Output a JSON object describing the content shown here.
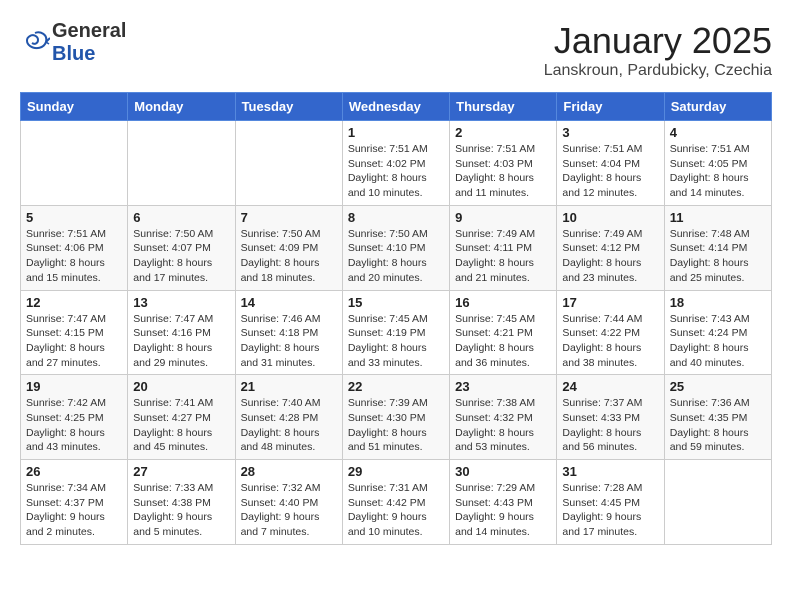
{
  "header": {
    "logo": {
      "general": "General",
      "blue": "Blue"
    },
    "title": "January 2025",
    "subtitle": "Lanskroun, Pardubicky, Czechia"
  },
  "weekdays": [
    "Sunday",
    "Monday",
    "Tuesday",
    "Wednesday",
    "Thursday",
    "Friday",
    "Saturday"
  ],
  "weeks": [
    [
      {
        "day": "",
        "detail": ""
      },
      {
        "day": "",
        "detail": ""
      },
      {
        "day": "",
        "detail": ""
      },
      {
        "day": "1",
        "detail": "Sunrise: 7:51 AM\nSunset: 4:02 PM\nDaylight: 8 hours\nand 10 minutes."
      },
      {
        "day": "2",
        "detail": "Sunrise: 7:51 AM\nSunset: 4:03 PM\nDaylight: 8 hours\nand 11 minutes."
      },
      {
        "day": "3",
        "detail": "Sunrise: 7:51 AM\nSunset: 4:04 PM\nDaylight: 8 hours\nand 12 minutes."
      },
      {
        "day": "4",
        "detail": "Sunrise: 7:51 AM\nSunset: 4:05 PM\nDaylight: 8 hours\nand 14 minutes."
      }
    ],
    [
      {
        "day": "5",
        "detail": "Sunrise: 7:51 AM\nSunset: 4:06 PM\nDaylight: 8 hours\nand 15 minutes."
      },
      {
        "day": "6",
        "detail": "Sunrise: 7:50 AM\nSunset: 4:07 PM\nDaylight: 8 hours\nand 17 minutes."
      },
      {
        "day": "7",
        "detail": "Sunrise: 7:50 AM\nSunset: 4:09 PM\nDaylight: 8 hours\nand 18 minutes."
      },
      {
        "day": "8",
        "detail": "Sunrise: 7:50 AM\nSunset: 4:10 PM\nDaylight: 8 hours\nand 20 minutes."
      },
      {
        "day": "9",
        "detail": "Sunrise: 7:49 AM\nSunset: 4:11 PM\nDaylight: 8 hours\nand 21 minutes."
      },
      {
        "day": "10",
        "detail": "Sunrise: 7:49 AM\nSunset: 4:12 PM\nDaylight: 8 hours\nand 23 minutes."
      },
      {
        "day": "11",
        "detail": "Sunrise: 7:48 AM\nSunset: 4:14 PM\nDaylight: 8 hours\nand 25 minutes."
      }
    ],
    [
      {
        "day": "12",
        "detail": "Sunrise: 7:47 AM\nSunset: 4:15 PM\nDaylight: 8 hours\nand 27 minutes."
      },
      {
        "day": "13",
        "detail": "Sunrise: 7:47 AM\nSunset: 4:16 PM\nDaylight: 8 hours\nand 29 minutes."
      },
      {
        "day": "14",
        "detail": "Sunrise: 7:46 AM\nSunset: 4:18 PM\nDaylight: 8 hours\nand 31 minutes."
      },
      {
        "day": "15",
        "detail": "Sunrise: 7:45 AM\nSunset: 4:19 PM\nDaylight: 8 hours\nand 33 minutes."
      },
      {
        "day": "16",
        "detail": "Sunrise: 7:45 AM\nSunset: 4:21 PM\nDaylight: 8 hours\nand 36 minutes."
      },
      {
        "day": "17",
        "detail": "Sunrise: 7:44 AM\nSunset: 4:22 PM\nDaylight: 8 hours\nand 38 minutes."
      },
      {
        "day": "18",
        "detail": "Sunrise: 7:43 AM\nSunset: 4:24 PM\nDaylight: 8 hours\nand 40 minutes."
      }
    ],
    [
      {
        "day": "19",
        "detail": "Sunrise: 7:42 AM\nSunset: 4:25 PM\nDaylight: 8 hours\nand 43 minutes."
      },
      {
        "day": "20",
        "detail": "Sunrise: 7:41 AM\nSunset: 4:27 PM\nDaylight: 8 hours\nand 45 minutes."
      },
      {
        "day": "21",
        "detail": "Sunrise: 7:40 AM\nSunset: 4:28 PM\nDaylight: 8 hours\nand 48 minutes."
      },
      {
        "day": "22",
        "detail": "Sunrise: 7:39 AM\nSunset: 4:30 PM\nDaylight: 8 hours\nand 51 minutes."
      },
      {
        "day": "23",
        "detail": "Sunrise: 7:38 AM\nSunset: 4:32 PM\nDaylight: 8 hours\nand 53 minutes."
      },
      {
        "day": "24",
        "detail": "Sunrise: 7:37 AM\nSunset: 4:33 PM\nDaylight: 8 hours\nand 56 minutes."
      },
      {
        "day": "25",
        "detail": "Sunrise: 7:36 AM\nSunset: 4:35 PM\nDaylight: 8 hours\nand 59 minutes."
      }
    ],
    [
      {
        "day": "26",
        "detail": "Sunrise: 7:34 AM\nSunset: 4:37 PM\nDaylight: 9 hours\nand 2 minutes."
      },
      {
        "day": "27",
        "detail": "Sunrise: 7:33 AM\nSunset: 4:38 PM\nDaylight: 9 hours\nand 5 minutes."
      },
      {
        "day": "28",
        "detail": "Sunrise: 7:32 AM\nSunset: 4:40 PM\nDaylight: 9 hours\nand 7 minutes."
      },
      {
        "day": "29",
        "detail": "Sunrise: 7:31 AM\nSunset: 4:42 PM\nDaylight: 9 hours\nand 10 minutes."
      },
      {
        "day": "30",
        "detail": "Sunrise: 7:29 AM\nSunset: 4:43 PM\nDaylight: 9 hours\nand 14 minutes."
      },
      {
        "day": "31",
        "detail": "Sunrise: 7:28 AM\nSunset: 4:45 PM\nDaylight: 9 hours\nand 17 minutes."
      },
      {
        "day": "",
        "detail": ""
      }
    ]
  ]
}
